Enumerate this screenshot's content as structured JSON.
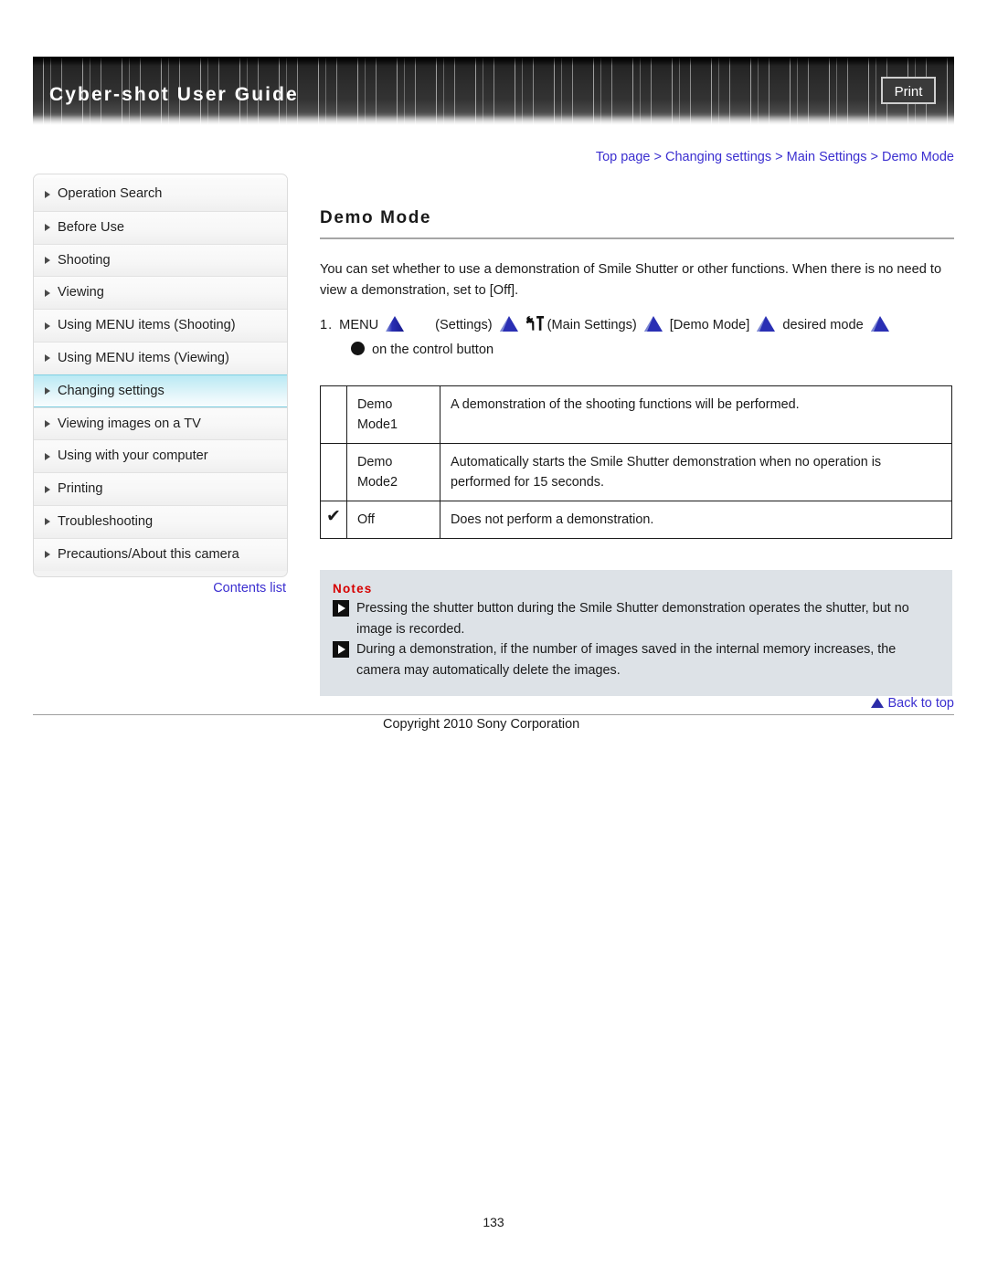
{
  "header": {
    "title": "Cyber-shot User Guide",
    "print_label": "Print"
  },
  "breadcrumb": {
    "items": [
      "Top page",
      "Changing settings",
      "Main Settings",
      "Demo Mode"
    ],
    "separator": ">"
  },
  "sidebar": {
    "items": [
      {
        "label": "Operation Search",
        "active": false
      },
      {
        "label": "Before Use",
        "active": false
      },
      {
        "label": "Shooting",
        "active": false
      },
      {
        "label": "Viewing",
        "active": false
      },
      {
        "label": "Using MENU items (Shooting)",
        "active": false
      },
      {
        "label": "Using MENU items (Viewing)",
        "active": false
      },
      {
        "label": "Changing settings",
        "active": true
      },
      {
        "label": "Viewing images on a TV",
        "active": false
      },
      {
        "label": "Using with your computer",
        "active": false
      },
      {
        "label": "Printing",
        "active": false
      },
      {
        "label": "Troubleshooting",
        "active": false
      },
      {
        "label": "Precautions/About this camera",
        "active": false
      }
    ],
    "contents_list_label": "Contents list"
  },
  "main": {
    "title": "Demo Mode",
    "intro": "You can set whether to use a demonstration of Smile Shutter or other functions. When there is no need to view a demonstration, set to [Off].",
    "step": {
      "number": "1.",
      "menu_label": "MENU",
      "settings_label": "(Settings)",
      "main_settings_label": "(Main Settings)",
      "demo_mode_label": "[Demo Mode]",
      "desired_mode_label": "desired mode",
      "control_button_label": "on the control button"
    },
    "table": {
      "rows": [
        {
          "checked": "",
          "label": "Demo Mode1",
          "description": "A demonstration of the shooting functions will be performed."
        },
        {
          "checked": "",
          "label": "Demo Mode2",
          "description": "Automatically starts the Smile Shutter demonstration when no operation is performed for 15 seconds."
        },
        {
          "checked": "✔",
          "label": "Off",
          "description": "Does not perform a demonstration."
        }
      ]
    },
    "notes": {
      "heading": "Notes",
      "items": [
        "Pressing the shutter button during the Smile Shutter demonstration operates the shutter, but no image is recorded.",
        "During a demonstration, if the number of images saved in the internal memory increases, the camera may automatically delete the images."
      ]
    }
  },
  "footer": {
    "back_to_top_label": "Back to top",
    "copyright": "Copyright 2010 Sony Corporation",
    "page_number": "133"
  },
  "colors": {
    "link": "#3b2fd0",
    "notes_heading": "#d60000",
    "notes_bg": "#dde2e7",
    "arrow_icon": "#2a2ab0",
    "active_item": "#b9e9f4"
  }
}
